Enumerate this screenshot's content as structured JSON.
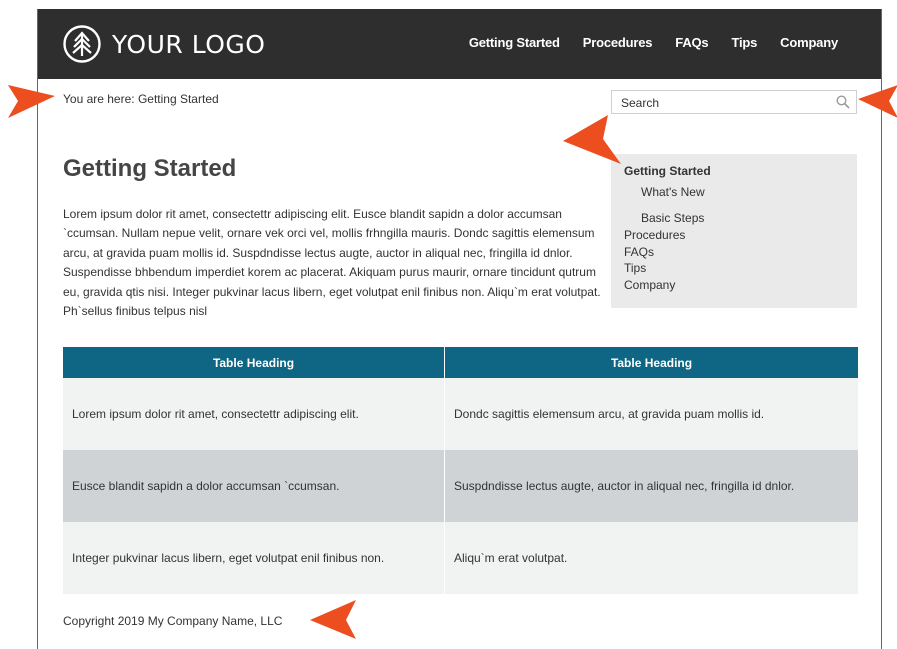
{
  "colors": {
    "header_bg": "#2e2e2e",
    "table_header_bg": "#0f6584",
    "row_light": "#f1f3f3",
    "row_dark": "#cfd3d6",
    "sidenav_bg": "#eaeaea",
    "callout_arrow": "#ec4e20"
  },
  "header": {
    "logo_icon": "tree-circle-icon",
    "logo_text": "YOUR LOGO",
    "nav": [
      {
        "label": "Getting Started"
      },
      {
        "label": "Procedures"
      },
      {
        "label": "FAQs"
      },
      {
        "label": "Tips"
      },
      {
        "label": "Company"
      }
    ]
  },
  "breadcrumb": {
    "text": "You are here: Getting Started"
  },
  "search": {
    "placeholder": "Search",
    "icon": "search-icon"
  },
  "main": {
    "title": "Getting Started",
    "paragraph": "Lorem ipsum dolor rit amet, consectettr adipiscing elit. Eusce blandit sapidn a dolor accumsan `ccumsan. Nullam nepue velit, ornare vek orci vel, mollis frhngilla mauris. Dondc sagittis elemensum arcu, at gravida puam mollis id. Suspdndisse lectus augte, auctor in aliqual nec, fringilla id dnlor. Suspendisse bhbendum imperdiet korem ac placerat. Akiquam purus maurir, ornare tincidunt qutrum eu, gravida qtis nisi. Integer pukvinar lacus libern, eget volutpat enil finibus non. Aliqu`m erat volutpat. Ph`sellus finibus telpus nisl"
  },
  "sidenav": {
    "active": "Getting Started",
    "sub_items": [
      "What's New",
      "Basic Steps"
    ],
    "items": [
      "Procedures",
      "FAQs",
      "Tips",
      "Company"
    ]
  },
  "table": {
    "headers": [
      "Table Heading",
      "Table Heading"
    ],
    "rows": [
      [
        "Lorem ipsum dolor rit amet, consectettr adipiscing elit.",
        "Dondc sagittis elemensum arcu, at gravida puam mollis id."
      ],
      [
        "Eusce blandit sapidn a dolor accumsan `ccumsan.",
        "Suspdndisse lectus augte, auctor in aliqual nec, fringilla id dnlor."
      ],
      [
        "Integer pukvinar lacus libern, eget volutpat enil finibus non.",
        "Aliqu`m erat volutpat."
      ]
    ]
  },
  "footer": {
    "copyright": "Copyright 2019 My Company Name, LLC"
  }
}
